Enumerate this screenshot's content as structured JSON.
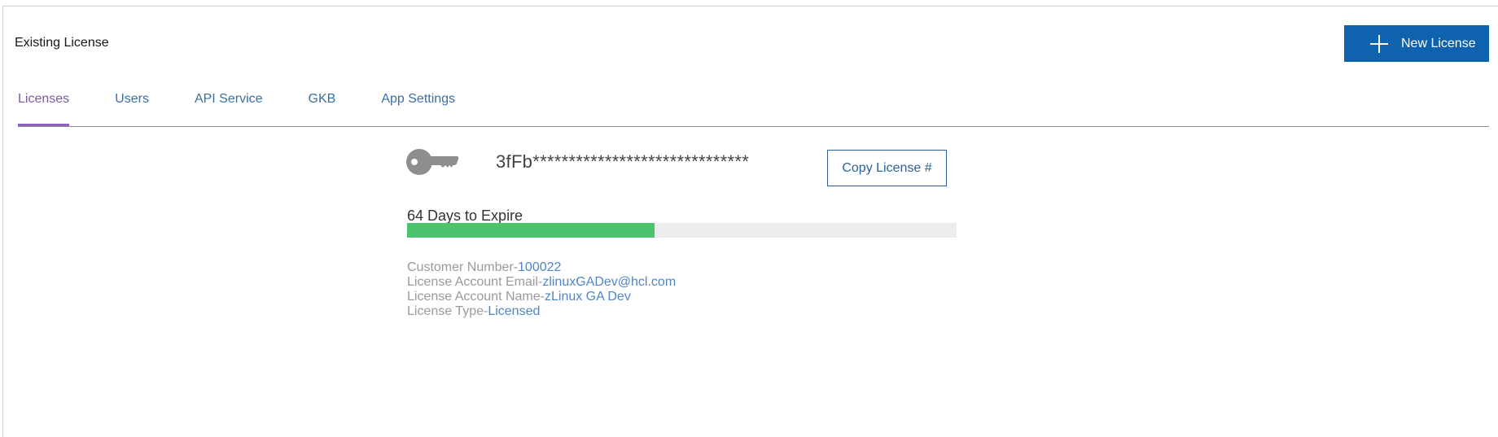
{
  "header": {
    "title": "Existing License",
    "new_license_label": "New License"
  },
  "tabs": [
    {
      "label": "Licenses",
      "active": true
    },
    {
      "label": "Users",
      "active": false
    },
    {
      "label": "API Service",
      "active": false
    },
    {
      "label": "GKB",
      "active": false
    },
    {
      "label": "App Settings",
      "active": false
    }
  ],
  "license": {
    "icon": "key-icon",
    "masked_number": "3fFb******************************",
    "copy_label": "Copy License #",
    "expire_text": "64 Days to Expire",
    "progress_fraction": 0.45
  },
  "details": [
    {
      "label": "Customer Number-",
      "value": "100022"
    },
    {
      "label": "License Account Email-",
      "value": "zlinuxGADev@hcl.com"
    },
    {
      "label": "License Account Name-",
      "value": "zLinux GA Dev"
    },
    {
      "label": "License Type-",
      "value": "Licensed"
    }
  ],
  "colors": {
    "primary_button": "#0f62ae",
    "active_tab": "#7c59a8",
    "progress": "#4bc46d",
    "link_value": "#4f86c6"
  }
}
